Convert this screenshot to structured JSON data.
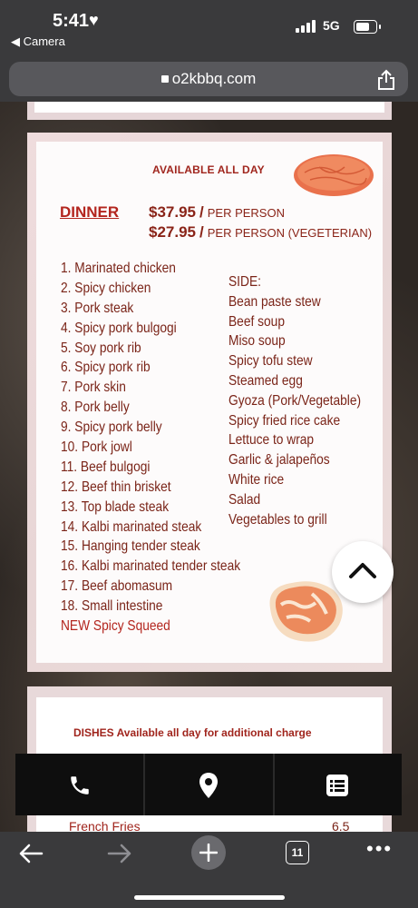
{
  "status_bar": {
    "time": "5:41",
    "back_app": "◀ Camera",
    "network": "5G"
  },
  "browser": {
    "url": "o2kbbq.com",
    "tab_count": "11"
  },
  "menu_card": {
    "available": "AVAILABLE ALL DAY",
    "dinner_label": "DINNER",
    "price1": "$37.95",
    "price1_note": "PER PERSON",
    "price2": "$27.95",
    "price2_note": "PER PERSON (VEGETERIAN)",
    "items": [
      "1. Marinated chicken",
      "2. Spicy chicken",
      "3. Pork steak",
      "4. Spicy pork bulgogi",
      "5. Soy pork rib",
      "6. Spicy pork rib",
      "7. Pork skin",
      "8. Pork belly",
      "9. Spicy pork belly",
      "10. Pork jowl",
      "11. Beef bulgogi",
      "12. Beef thin brisket",
      "13. Top blade steak",
      "14. Kalbi marinated steak",
      "15. Hanging tender steak",
      "16. Kalbi marinated tender steak",
      "17. Beef abomasum",
      "18. Small intestine"
    ],
    "new_item": "NEW Spicy Squeed",
    "side_title": "SIDE:",
    "sides": [
      "Bean paste stew",
      "Beef soup",
      "Miso soup",
      "Spicy tofu stew",
      "Steamed egg",
      "Gyoza (Pork/Vegetable)",
      "Spicy fried rice cake",
      "Lettuce to wrap",
      "Garlic & jalapeños",
      "White rice",
      "Salad",
      "Vegetables to grill"
    ]
  },
  "dishes_card": {
    "title": "DISHES Available all day for additional charge",
    "item": "French Fries",
    "price": "6.5"
  },
  "colors": {
    "accent_red": "#b3251e",
    "menu_text": "#7a2418"
  }
}
